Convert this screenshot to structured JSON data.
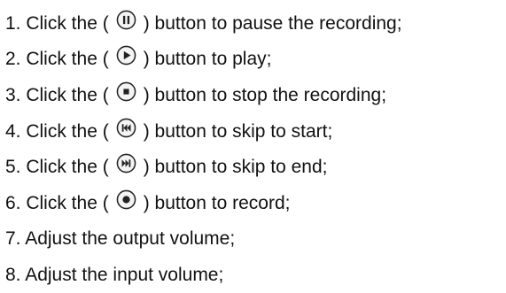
{
  "steps": [
    {
      "prefix": "1. Click the (",
      "icon": "pause-icon",
      "suffix": ") button to pause the recording;"
    },
    {
      "prefix": "2. Click the (",
      "icon": "play-icon",
      "suffix": ") button to play;"
    },
    {
      "prefix": "3. Click the (",
      "icon": "stop-icon",
      "suffix": ") button to stop the recording;"
    },
    {
      "prefix": "4. Click the (",
      "icon": "skip-to-start-icon",
      "suffix": ") button to skip to start;"
    },
    {
      "prefix": "5. Click the (",
      "icon": "skip-to-end-icon",
      "suffix": ") button to skip to end;"
    },
    {
      "prefix": "6. Click the (",
      "icon": "record-icon",
      "suffix": ") button to record;"
    },
    {
      "text": "7. Adjust the output volume;"
    },
    {
      "text": "8. Adjust the input volume;"
    }
  ],
  "colors": {
    "text": "#111111",
    "icon_outline": "#222222",
    "icon_fill": "#f4f4f4"
  }
}
